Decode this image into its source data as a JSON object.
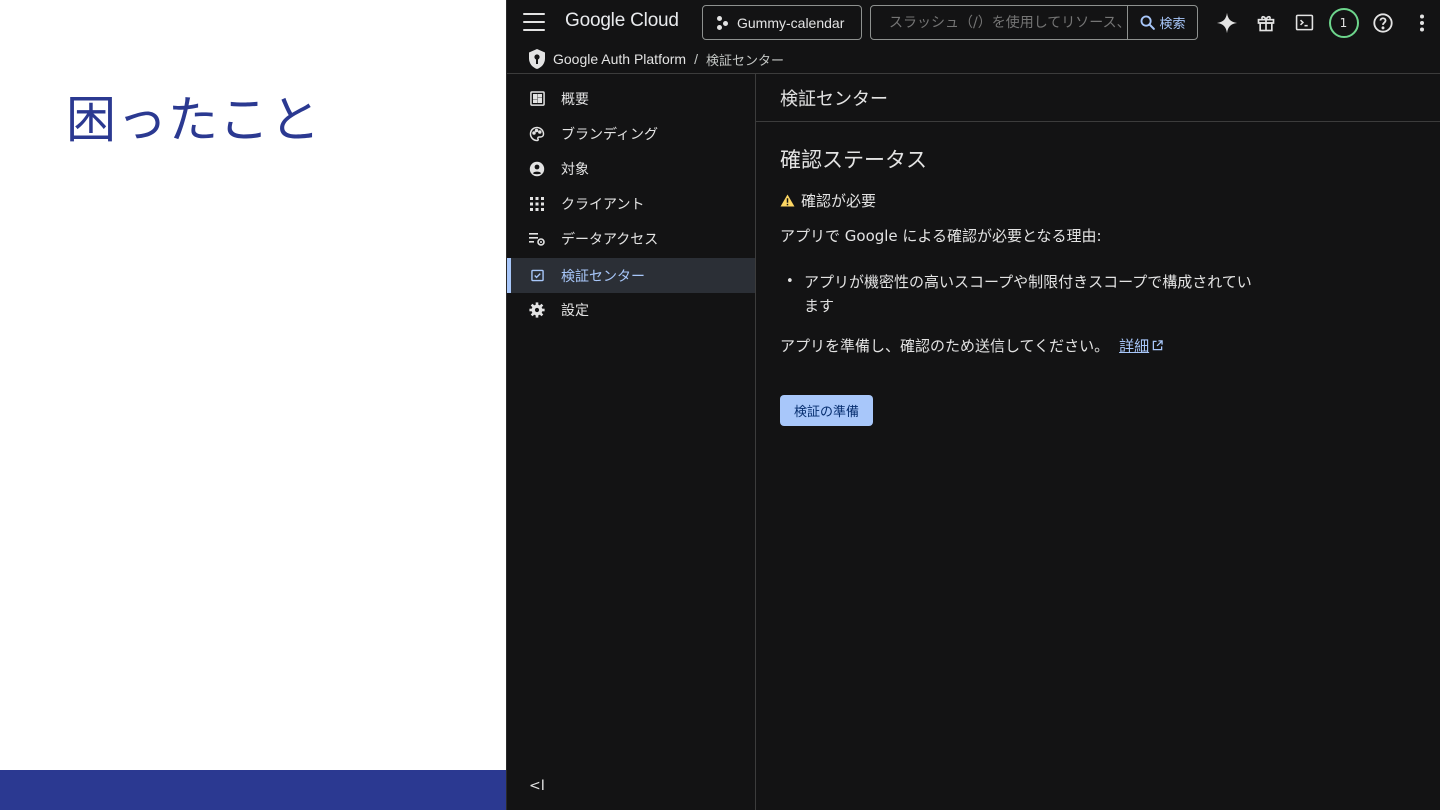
{
  "slide": {
    "title": "困ったこと"
  },
  "topbar": {
    "brand": "Google Cloud",
    "project_name": "Gummy-calendar",
    "search_placeholder": "スラッシュ（/）を使用してリソース、...",
    "search_button": "検索",
    "notification_count": "1"
  },
  "breadcrumb": {
    "product": "Google Auth Platform",
    "separator": "/",
    "current": "検証センター"
  },
  "sidebar": {
    "items": [
      {
        "label": "概要",
        "icon": "dashboard-icon"
      },
      {
        "label": "ブランディング",
        "icon": "palette-icon"
      },
      {
        "label": "対象",
        "icon": "account-circle-icon"
      },
      {
        "label": "クライアント",
        "icon": "apps-grid-icon"
      },
      {
        "label": "データアクセス",
        "icon": "list-settings-icon"
      },
      {
        "label": "検証センター",
        "icon": "verified-checkbox-icon",
        "active": true
      },
      {
        "label": "設定",
        "icon": "gear-icon"
      }
    ],
    "collapse_label": "<I"
  },
  "main": {
    "page_title": "検証センター",
    "section_title": "確認ステータス",
    "status_text": "確認が必要",
    "reason_title": "アプリで Google による確認が必要となる理由:",
    "reasons": [
      "アプリが機密性の高いスコープや制限付きスコープで構成されています"
    ],
    "submit_text": "アプリを準備し、確認のため送信してください。",
    "detail_link": "詳細",
    "prepare_button": "検証の準備"
  },
  "colors": {
    "slide_accent": "#2b3991",
    "console_bg": "#131314",
    "link": "#a8c7fa",
    "primary_button": "#a8c7fa",
    "warning": "#fdd663",
    "notification_ring": "#6dd58c"
  }
}
